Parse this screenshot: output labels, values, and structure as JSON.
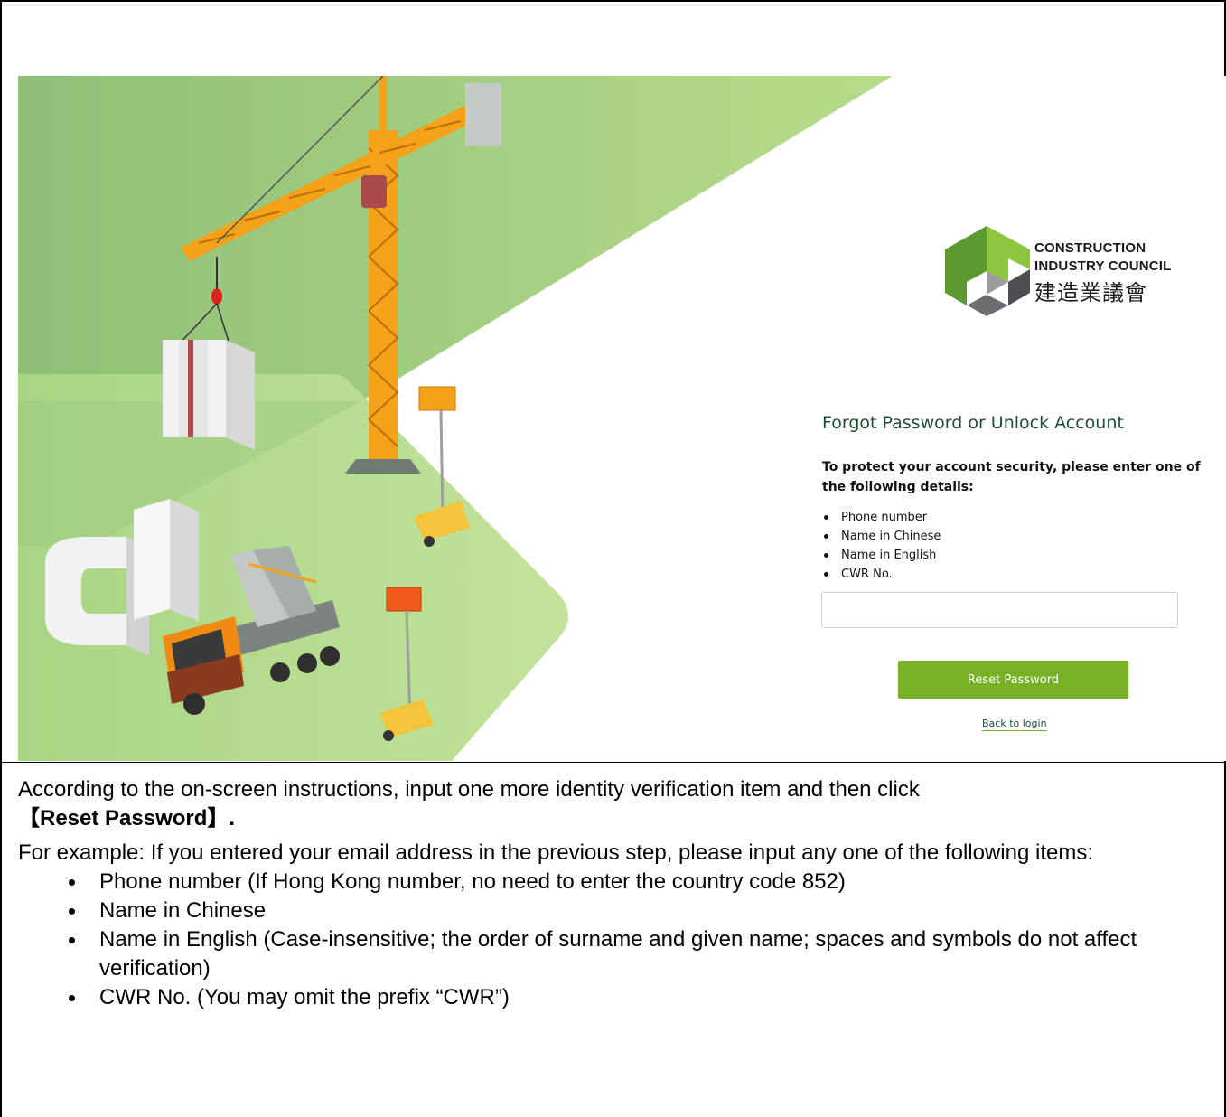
{
  "screenshot": {
    "logo": {
      "name_en_line1": "CONSTRUCTION",
      "name_en_line2": "INDUSTRY COUNCIL",
      "name_zh": "建造業議會"
    },
    "form": {
      "title": "Forgot Password or Unlock Account",
      "intro": "To protect your account security, please enter one of the following details:",
      "options": [
        "Phone number",
        "Name in Chinese",
        "Name in English",
        "CWR No."
      ],
      "input_value": "",
      "reset_button_label": "Reset Password",
      "back_link_label": "Back to login"
    },
    "colors": {
      "accent_green": "#77b124",
      "title_green": "#1f4f32",
      "crane_orange": "#f5a21b"
    }
  },
  "instructions": {
    "line1_prefix": "According to the on-screen instructions, input one more identity verification item and then click",
    "line1_button": "【Reset Password】.",
    "line2": "For example: If you entered your email address in the previous step, please input any one of the following items:",
    "items": [
      "Phone number (If Hong Kong number, no need to enter the country code 852)",
      "Name in Chinese",
      "Name in English (Case-insensitive; the order of surname and given name; spaces and symbols do not affect verification)",
      "CWR No. (You may omit the prefix “CWR”)"
    ]
  }
}
